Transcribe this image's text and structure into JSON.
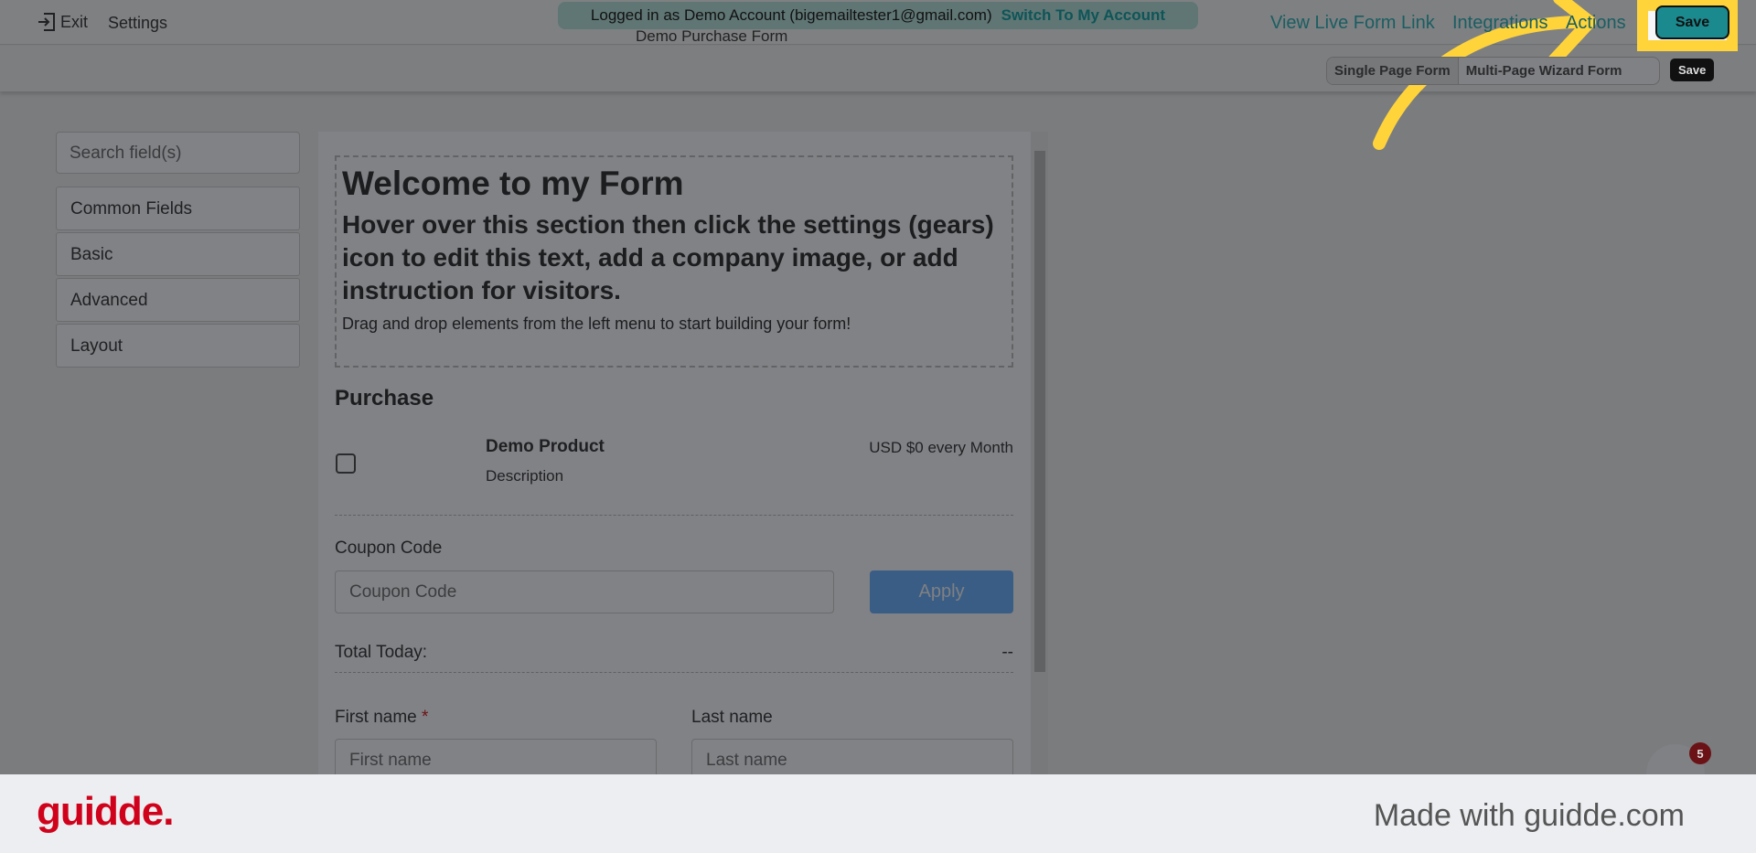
{
  "topbar": {
    "exit": "Exit",
    "settings": "Settings",
    "form_name": "Demo Purchase Form",
    "banner_text": "Logged in as Demo Account (bigemailtester1@gmail.com)",
    "switch_account": "Switch To My Account",
    "view_live": "View Live Form Link",
    "integrations": "Integrations",
    "actions": "Actions",
    "save": "Save"
  },
  "subbar": {
    "single_page": "Single Page Form",
    "multi_page": "Multi-Page Wizard Form",
    "tooltip": "Save"
  },
  "sidebar": {
    "search_placeholder": "Search field(s)",
    "categories": [
      "Common Fields",
      "Basic",
      "Advanced",
      "Layout"
    ]
  },
  "form": {
    "title": "Welcome to my Form",
    "subtitle": "Hover over this section then click the settings (gears) icon to edit this text, add a company image, or add instruction for visitors.",
    "instructions": "Drag and drop elements from the left menu to start building your form!",
    "purchase_heading": "Purchase",
    "product_name": "Demo Product",
    "product_desc": "Description",
    "product_price": "USD $0 every Month",
    "coupon_label": "Coupon Code",
    "coupon_placeholder": "Coupon Code",
    "apply": "Apply",
    "total_label": "Total Today:",
    "total_value": "--",
    "first_name_label": "First name",
    "required_mark": "*",
    "last_name_label": "Last name",
    "first_name_placeholder": "First name",
    "last_name_placeholder": "Last name"
  },
  "chat": {
    "badge": "5"
  },
  "footer": {
    "logo": "guidde.",
    "made_with": "Made with guidde.com"
  },
  "colors": {
    "accent": "#1b8a8f",
    "highlight": "#ffd43b",
    "brand": "#d0021b"
  }
}
